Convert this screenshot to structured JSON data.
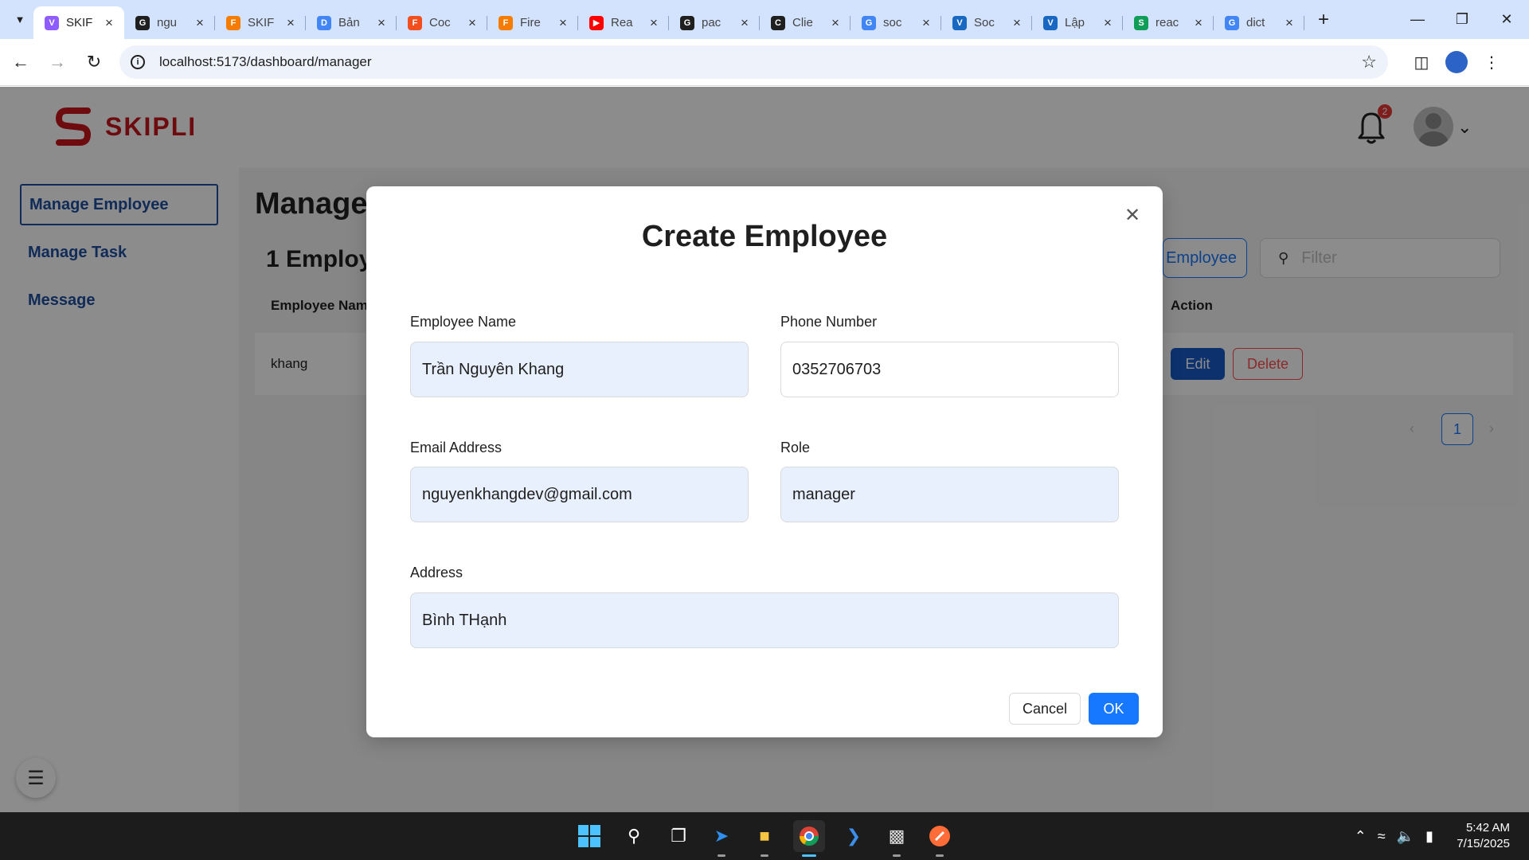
{
  "browser": {
    "tabs": [
      {
        "label": "SKIF",
        "favicon": "vite-icon",
        "color": "#8f5cff",
        "active": true
      },
      {
        "label": "ngu",
        "favicon": "github-icon",
        "color": "#1f1f1f"
      },
      {
        "label": "SKIF",
        "favicon": "firebase-icon",
        "color": "#f57c00"
      },
      {
        "label": "Bản",
        "favicon": "google-docs-icon",
        "color": "#4285f4"
      },
      {
        "label": "Coc",
        "favicon": "figma-icon",
        "color": "#f24e1e"
      },
      {
        "label": "Fire",
        "favicon": "firebase-icon",
        "color": "#f57c00"
      },
      {
        "label": "Rea",
        "favicon": "youtube-icon",
        "color": "#ff0000"
      },
      {
        "label": "pac",
        "favicon": "github-icon",
        "color": "#1f1f1f"
      },
      {
        "label": "Clie",
        "favicon": "compass-icon",
        "color": "#1f1f1f"
      },
      {
        "label": "soc",
        "favicon": "google-icon",
        "color": "#4285f4"
      },
      {
        "label": "Soc",
        "favicon": "vuetify-icon",
        "color": "#1867c0"
      },
      {
        "label": "Lập",
        "favicon": "vuetify-icon",
        "color": "#1867c0"
      },
      {
        "label": "reac",
        "favicon": "sheets-icon",
        "color": "#0f9d58"
      },
      {
        "label": "dict",
        "favicon": "google-icon",
        "color": "#4285f4"
      }
    ],
    "url": "localhost:5173/dashboard/manager"
  },
  "app": {
    "logo_text": "SKIPLI",
    "brand_color": "#c8141d",
    "notification_count": "2",
    "sidebar": [
      {
        "label": "Manage Employee",
        "active": true
      },
      {
        "label": "Manage Task"
      },
      {
        "label": "Message"
      }
    ],
    "page_title": "Manage",
    "employee_count_text": "1 Employ",
    "create_button_label": "Employee",
    "filter_placeholder": "Filter",
    "table": {
      "columns": [
        "Employee Nam",
        "Action"
      ],
      "rows": [
        {
          "name": "khang",
          "edit": "Edit",
          "delete": "Delete"
        }
      ]
    },
    "pagination": {
      "current": "1"
    }
  },
  "modal": {
    "title": "Create Employee",
    "fields": {
      "name": {
        "label": "Employee Name",
        "value": "Trần Nguyên Khang"
      },
      "phone": {
        "label": "Phone Number",
        "value": "0352706703"
      },
      "email": {
        "label": "Email Address",
        "value": "nguyenkhangdev@gmail.com"
      },
      "role": {
        "label": "Role",
        "value": "manager"
      },
      "address": {
        "label": "Address",
        "value": "Bình THạnh"
      }
    },
    "cancel_label": "Cancel",
    "ok_label": "OK",
    "accent": "#1677ff"
  },
  "taskbar": {
    "time": "5:42 AM",
    "date": "7/15/2025"
  }
}
